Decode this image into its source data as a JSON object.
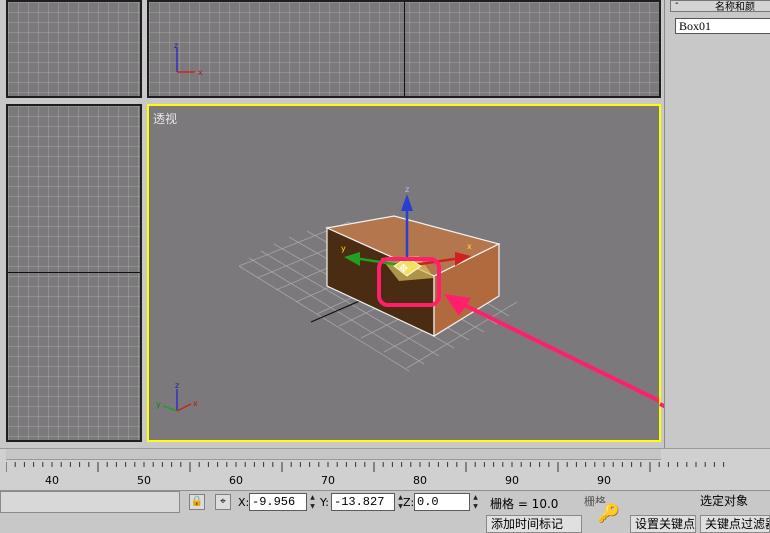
{
  "viewports": {
    "perspective_label": "透视",
    "axis": {
      "x": "x",
      "y": "y",
      "z": "z"
    }
  },
  "command_panel": {
    "rollout_minus": "-",
    "rollout_title": "名称和颜",
    "object_name": "Box01"
  },
  "time_ruler": {
    "ticks": [
      "40",
      "50",
      "60",
      "70",
      "80",
      "90",
      "90"
    ]
  },
  "status_bar": {
    "x_label": "X:",
    "x_value": "-9.956",
    "y_label": "Y:",
    "y_value": "-13.827",
    "z_label": "Z:",
    "z_value": "0.0",
    "grid_text": "栅格 = 10.0",
    "auto_key_partial": "栅格",
    "selected_object_label": "选定对象",
    "add_time_tag": "添加时间标记",
    "set_key": "设置关键点",
    "key_filters": "关键点过滤器"
  },
  "colors": {
    "active_viewport_border": "#ffff00",
    "annotation": "#ff1f6a",
    "box": "#b4764d"
  }
}
